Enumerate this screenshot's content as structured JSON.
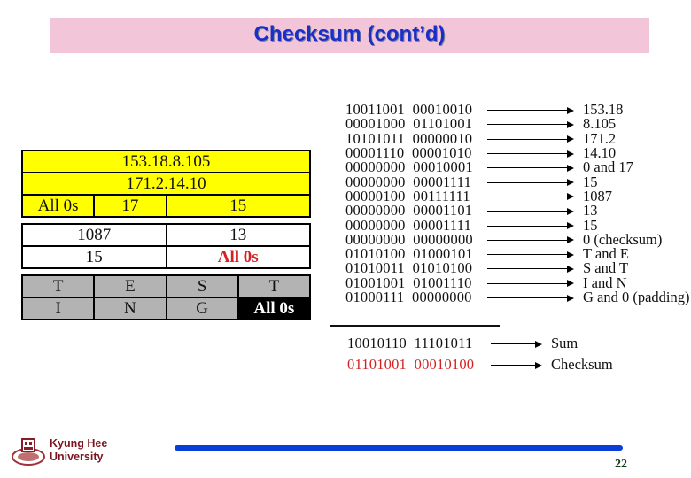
{
  "slide": {
    "title": "Checksum (cont’d)",
    "page_number": "22"
  },
  "packet": {
    "header_rows": [
      {
        "cells": [
          "153.18.8.105"
        ]
      },
      {
        "cells": [
          "171.2.14.10"
        ]
      },
      {
        "cells": [
          "All 0s",
          "17",
          "15"
        ]
      }
    ],
    "udp_rows": [
      {
        "cells": [
          "1087",
          "13"
        ]
      },
      {
        "cells": [
          "15",
          "All 0s"
        ]
      }
    ],
    "data_rows": [
      {
        "cells": [
          "T",
          "E",
          "S",
          "T"
        ]
      },
      {
        "cells": [
          "I",
          "N",
          "G",
          "All 0s"
        ]
      }
    ]
  },
  "calculation": {
    "rows": [
      {
        "bits": "10011001  00010010",
        "result": "153.18"
      },
      {
        "bits": "00001000  01101001",
        "result": "8.105"
      },
      {
        "bits": "10101011  00000010",
        "result": "171.2"
      },
      {
        "bits": "00001110  00001010",
        "result": "14.10"
      },
      {
        "bits": "00000000  00010001",
        "result": "0 and 17"
      },
      {
        "bits": "00000000  00001111",
        "result": "15"
      },
      {
        "bits": "00000100  00111111",
        "result": "1087"
      },
      {
        "bits": "00000000  00001101",
        "result": "13"
      },
      {
        "bits": "00000000  00001111",
        "result": "15"
      },
      {
        "bits": "00000000  00000000",
        "result": "0 (checksum)"
      },
      {
        "bits": "01010100  01000101",
        "result": "T and E"
      },
      {
        "bits": "01010011  01010100",
        "result": "S and T"
      },
      {
        "bits": "01001001  01001110",
        "result": "I and N"
      },
      {
        "bits": "01000111  00000000",
        "result": "G and 0 (padding)"
      }
    ],
    "sum": {
      "bits": "10010110  11101011",
      "label": "Sum"
    },
    "checksum": {
      "bits": "01101001  00010100",
      "label": "Checksum"
    }
  },
  "footer": {
    "university_line1": "Kyung Hee",
    "university_line2": "University"
  },
  "colors": {
    "title_text": "#1a2ec8",
    "title_bg": "#f2c6d8",
    "ip_header": "#ffff00",
    "data_gray": "#b3b3b3",
    "highlight_red": "#d42020",
    "footer_bar": "#0a3ed8",
    "university": "#7a1420"
  }
}
